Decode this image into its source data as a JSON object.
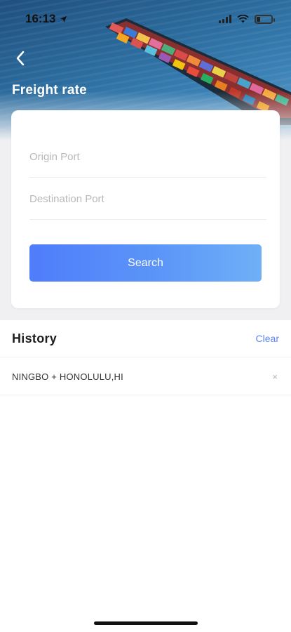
{
  "status_bar": {
    "time": "16:13"
  },
  "header": {
    "title": "Freight rate"
  },
  "search_form": {
    "origin_placeholder": "Origin Port",
    "origin_value": "",
    "destination_placeholder": "Destination Port",
    "destination_value": "",
    "search_label": "Search"
  },
  "history": {
    "title": "History",
    "clear_label": "Clear",
    "items": [
      {
        "label": "NINGBO + HONOLULU,HI",
        "remove_label": "×"
      }
    ]
  },
  "colors": {
    "accent": "#5b8af9",
    "link": "#5a86f0",
    "background_band": "#f0f0f2"
  }
}
